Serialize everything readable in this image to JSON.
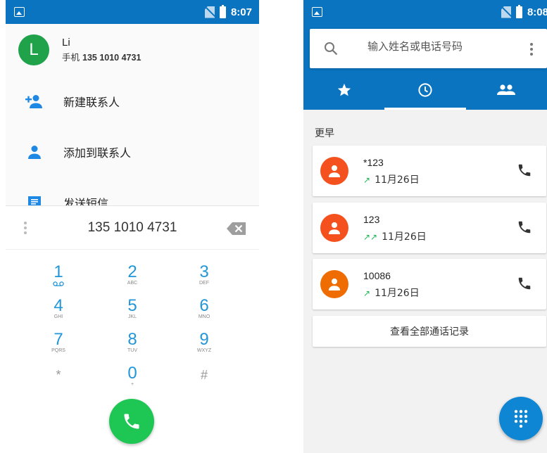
{
  "status_left": {
    "time": "8:07"
  },
  "status_right": {
    "time": "8:08"
  },
  "contact": {
    "initial": "L",
    "name": "Li",
    "number_label": "手机",
    "number": "135 1010 4731"
  },
  "actions": [
    {
      "label": "新建联系人",
      "icon": "person-add-icon"
    },
    {
      "label": "添加到联系人",
      "icon": "person-icon"
    },
    {
      "label": "发送短信",
      "icon": "message-icon"
    }
  ],
  "dialpad": {
    "digits": "135 1010 4731",
    "keys": [
      {
        "digit": "1",
        "letters": ""
      },
      {
        "digit": "2",
        "letters": "ABC"
      },
      {
        "digit": "3",
        "letters": "DEF"
      },
      {
        "digit": "4",
        "letters": "GHI"
      },
      {
        "digit": "5",
        "letters": "JKL"
      },
      {
        "digit": "6",
        "letters": "MNO"
      },
      {
        "digit": "7",
        "letters": "PQRS"
      },
      {
        "digit": "8",
        "letters": "TUV"
      },
      {
        "digit": "9",
        "letters": "WXYZ"
      },
      {
        "digit": "*",
        "letters": ""
      },
      {
        "digit": "0",
        "letters": "+"
      },
      {
        "digit": "#",
        "letters": ""
      }
    ]
  },
  "search": {
    "placeholder": "输入姓名或电话号码"
  },
  "section_title": "更早",
  "calls": [
    {
      "name": "*123",
      "arrows": "↗",
      "date": "11月26日",
      "avatar_color": "#f4511e"
    },
    {
      "name": "123",
      "arrows": "↗↗",
      "date": "11月26日",
      "avatar_color": "#f4511e"
    },
    {
      "name": "10086",
      "arrows": "↗",
      "date": "11月26日",
      "avatar_color": "#ef6c00"
    }
  ],
  "view_all_label": "查看全部通话记录",
  "colors": {
    "primary": "#0a74c0",
    "call_green": "#1ec753",
    "contact_green": "#1fa24a",
    "fab_blue": "#0e86d4",
    "outgoing_green": "#1fb656"
  }
}
